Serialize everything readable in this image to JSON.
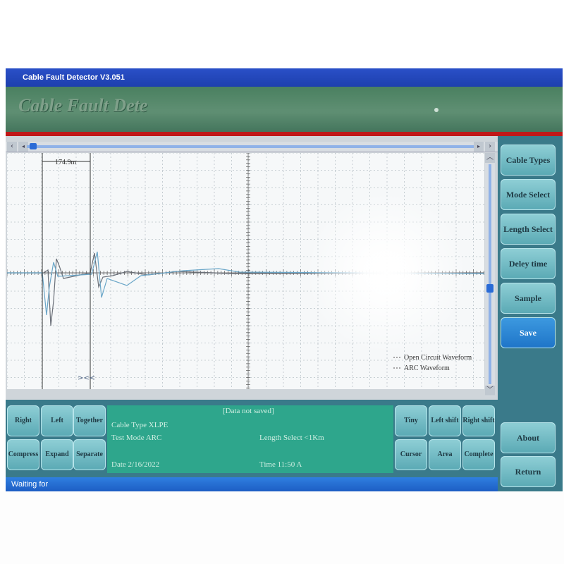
{
  "window": {
    "title": "Cable Fault Detector  V3.051"
  },
  "banner": {
    "title": "Cable Fault Dete"
  },
  "scope": {
    "marker_distance": "174.9m",
    "legend": {
      "open_circuit": "Open Circuit Waveform",
      "arc": "ARC Waveform"
    },
    "colors": {
      "open_circuit": "#6a6f78",
      "arc": "#6aa6c8",
      "grid": "#b9c2c8",
      "axis": "#444"
    }
  },
  "side_menu": {
    "items": [
      "Cable Types",
      "Mode Select",
      "Length Select",
      "Deley time",
      "Sample",
      "Save"
    ],
    "active": "Save",
    "lower": [
      "About",
      "Return"
    ]
  },
  "controls": {
    "left_group": [
      "Right",
      "Left",
      "Together",
      "Compress",
      "Expand",
      "Separate"
    ],
    "right_group": [
      "Tiny",
      "Left shift",
      "Right shift",
      "Cursor",
      "Area",
      "Complete"
    ]
  },
  "info": {
    "status": "[Data not saved]",
    "cable_type": "Cable Type XLPE",
    "test_mode": "Test Mode ARC",
    "length_select": "Length Select <1Km",
    "date": "Date 2/16/2022",
    "time": "Time  11:50 A"
  },
  "statusbar": {
    "text": "Waiting for"
  },
  "icons": {
    "scroll_left": "chevron-left-icon",
    "scroll_right": "chevron-right-icon",
    "scroll_up": "chevron-up-icon",
    "scroll_down": "chevron-down-icon"
  }
}
